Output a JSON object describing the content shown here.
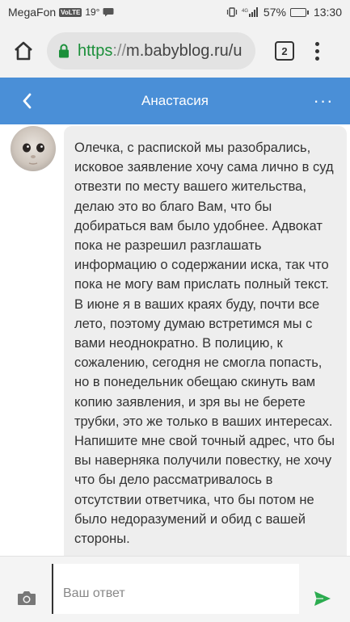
{
  "status_bar": {
    "carrier": "MegaFon",
    "volte": "VoLTE",
    "temperature": "19°",
    "network": "4G",
    "battery_percent": "57%",
    "battery_level": 0.57,
    "time": "13:30"
  },
  "browser": {
    "url_scheme": "https",
    "url_separator": "://",
    "url_host": "m.babyblog.ru/u",
    "tab_count": "2"
  },
  "header": {
    "title": "Анастасия"
  },
  "chat": {
    "messages": [
      {
        "text": "Олечка, с распиской мы разобрались, исковое заявление хочу сама лично в суд отвезти по месту вашего жительства, делаю это во благо Вам, что бы добираться вам было удобнее. Адвокат пока не разрешил разглашать информацию о содержании иска, так что пока не могу вам прислать полный текст. В июне я в ваших краях буду, почти все лето, поэтому думаю встретимся мы с вами неоднократно. В полицию, к сожалению, сегодня не смогла попасть, но в понедельник обещаю скинуть вам копию заявления, и зря вы не берете трубки, это же только в ваших интересах. Напишите мне свой точный адрес, что бы вы наверняка получили повестку, не хочу что бы дело рассматривалось в отсутствии ответчика, что бы потом не было недоразумений и обид с вашей стороны."
      }
    ]
  },
  "input": {
    "placeholder": "Ваш ответ",
    "value": ""
  },
  "colors": {
    "header_bg": "#4a8fd7",
    "send_icon": "#2bab4f",
    "lock_icon": "#1b8f3a"
  }
}
